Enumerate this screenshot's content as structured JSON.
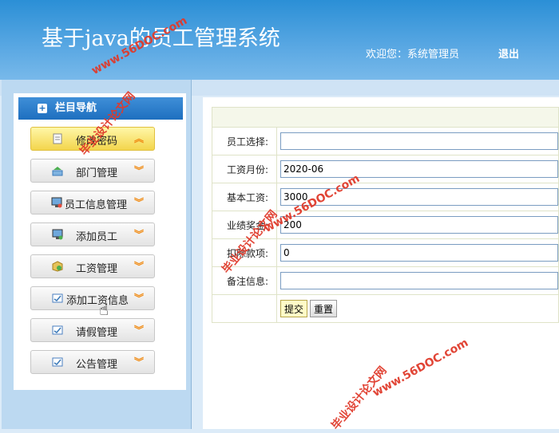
{
  "header": {
    "title": "基于java的员工管理系统",
    "welcome": "欢迎您：系统管理员",
    "logout": "退出"
  },
  "sidebar": {
    "title": "栏目导航",
    "items": [
      {
        "label": "修改密码",
        "icon": "document-edit-icon",
        "active": true
      },
      {
        "label": "部门管理",
        "icon": "department-icon",
        "active": false
      },
      {
        "label": "员工信息管理",
        "icon": "employee-monitor-icon",
        "active": false
      },
      {
        "label": "添加员工",
        "icon": "monitor-add-icon",
        "active": false
      },
      {
        "label": "工资管理",
        "icon": "salary-box-icon",
        "active": false
      },
      {
        "label": "添加工资信息",
        "icon": "edit-check-icon",
        "active": false
      },
      {
        "label": "请假管理",
        "icon": "edit-check-icon",
        "active": false
      },
      {
        "label": "公告管理",
        "icon": "edit-check-icon",
        "active": false
      }
    ]
  },
  "form": {
    "rows": [
      {
        "label": "员工选择:",
        "value": ""
      },
      {
        "label": "工资月份:",
        "value": "2020-06"
      },
      {
        "label": "基本工资:",
        "value": "3000"
      },
      {
        "label": "业绩奖金:",
        "value": "200"
      },
      {
        "label": "扣除款项:",
        "value": "0"
      },
      {
        "label": "备注信息:",
        "value": ""
      }
    ],
    "submit": "提交",
    "reset": "重置"
  },
  "watermark": {
    "site": "www.56DOC.com",
    "name": "毕业设计论文网"
  },
  "colors": {
    "header": "#2b8fd6",
    "active_menu": "#f3d54c",
    "chevron": "#f08b14",
    "watermark": "#e03a2b"
  }
}
